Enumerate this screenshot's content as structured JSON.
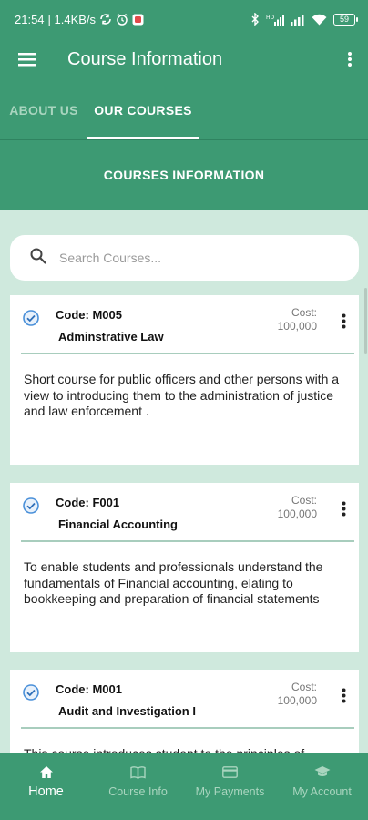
{
  "status_bar": {
    "time": "21:54",
    "network_speed": "| 1.4KB/s",
    "battery": "59",
    "icons": [
      "sync-icon",
      "alarm-icon",
      "app-notification-icon",
      "bluetooth-icon",
      "hd-signal-icon",
      "signal-icon",
      "wifi-icon",
      "battery-icon"
    ]
  },
  "app_bar": {
    "title": "Course Information",
    "icons": [
      "menu-icon",
      "more-vert-icon"
    ]
  },
  "tabs": [
    {
      "label": "ABOUT US",
      "active": false
    },
    {
      "label": "OUR COURSES",
      "active": true
    }
  ],
  "section": {
    "title": "COURSES INFORMATION"
  },
  "search": {
    "placeholder": "Search Courses...",
    "value": ""
  },
  "courses": [
    {
      "code": "Code: M005",
      "name": "Adminstrative Law",
      "cost_label": "Cost:",
      "cost": "100,000",
      "description": "Short course for public officers and other persons with a view to introducing them to the administration of justice and law enforcement ."
    },
    {
      "code": "Code: F001",
      "name": "Financial Accounting",
      "cost_label": "Cost:",
      "cost": "100,000",
      "description": "To enable students and professionals understand the fundamentals of Financial accounting, elating to bookkeeping and preparation of financial statements"
    },
    {
      "code": "Code: M001",
      "name": "Audit and Investigation I",
      "cost_label": "Cost:",
      "cost": "100,000",
      "description": "This course introduces student to the principles of"
    }
  ],
  "bottom_nav": [
    {
      "label": "Home",
      "icon": "home-icon",
      "active": true
    },
    {
      "label": "Course Info",
      "icon": "book-icon",
      "active": false
    },
    {
      "label": "My Payments",
      "icon": "credit-card-icon",
      "active": false
    },
    {
      "label": "My Account",
      "icon": "graduation-cap-icon",
      "active": false
    }
  ],
  "colors": {
    "primary": "#3d9a73",
    "background": "#cfe9dd",
    "inactive_text": "#a9d5bf",
    "check_accent": "#4a90d9"
  }
}
